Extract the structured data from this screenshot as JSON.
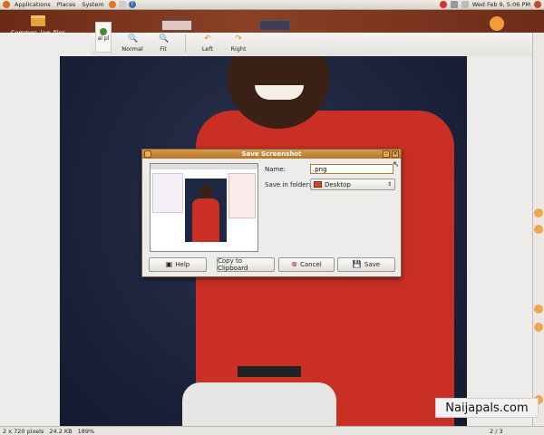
{
  "top_panel": {
    "menus": [
      "Applications",
      "Places",
      "System"
    ],
    "clock": "Wed Feb 9, 5:06 PM"
  },
  "desktop": {
    "icon_label": "Common_law_files"
  },
  "viewer": {
    "toolbar": {
      "normal": "Normal",
      "fit": "Fit",
      "left": "Left",
      "right": "Right",
      "partial_label": "al pl",
      "partial_label2": "ut"
    },
    "status": {
      "dimensions": "2 x 720 pixels",
      "size": "24.2 KB",
      "zoom": "189%",
      "page": "2 / 3"
    }
  },
  "dialog": {
    "title": "Save Screenshot",
    "name_label": "Name:",
    "name_value": ".png",
    "folder_label": "Save in folder:",
    "folder_value": "Desktop",
    "buttons": {
      "help": "Help",
      "clipboard": "Copy to Clipboard",
      "cancel": "Cancel",
      "save": "Save"
    }
  },
  "watermark": "Naijapals.com",
  "colors": {
    "title_bar": "#c8862f",
    "shirt": "#c92f25",
    "backdrop": "#1a2038"
  }
}
